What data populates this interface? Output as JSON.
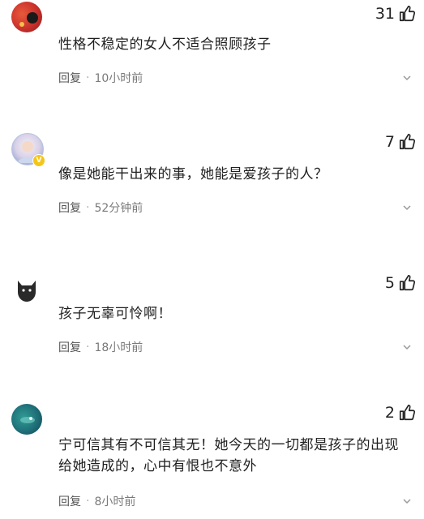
{
  "comments": [
    {
      "likes": "31",
      "text": "性格不稳定的女人不适合照顾孩子",
      "reply_label": "回复",
      "separator": "·",
      "time": "10小时前",
      "avatar_icon": "red-avatar-icon"
    },
    {
      "likes": "7",
      "text": "像是她能干出来的事，她能是爱孩子的人？",
      "reply_label": "回复",
      "separator": "·",
      "time": "52分钟前",
      "avatar_icon": "blue-avatar-icon",
      "verified_badge": "V"
    },
    {
      "likes": "5",
      "text": "孩子无辜可怜啊！",
      "reply_label": "回复",
      "separator": "·",
      "time": "18小时前",
      "avatar_icon": "black-cat-avatar-icon"
    },
    {
      "likes": "2",
      "text": "宁可信其有不可信其无！她今天的一切都是孩子的出现给她造成的，心中有恨也不意外",
      "reply_label": "回复",
      "separator": "·",
      "time": "8小时前",
      "avatar_icon": "teal-avatar-icon"
    }
  ],
  "colors": {
    "text": "#1f1f1f",
    "meta": "#7a7a7a",
    "badge": "#f5c518"
  }
}
